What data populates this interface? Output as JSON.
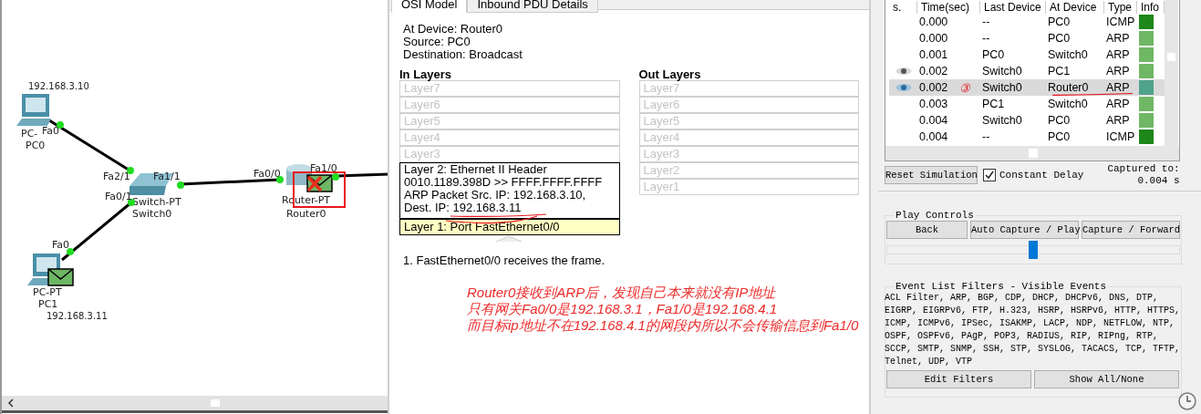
{
  "topology": {
    "devices": [
      {
        "kind": "pc",
        "model": "PC-",
        "name": "PC0",
        "ip": "192.168.3.10"
      },
      {
        "kind": "pc",
        "model": "PC-PT",
        "name": "PC1",
        "ip": "192.168.3.11",
        "has_pdu": true,
        "failed": false
      },
      {
        "kind": "switch",
        "model": "Switch-PT",
        "name": "Switch0"
      },
      {
        "kind": "router",
        "model": "Router-PT",
        "name": "Router0",
        "has_pdu": true,
        "failed": true,
        "highlighted": true
      }
    ],
    "ports": [
      "Fa0",
      "Fa2/1",
      "Fa1/1",
      "Fa0/1",
      "Fa0",
      "Fa0/0",
      "Fa1/0"
    ]
  },
  "pdu_window": {
    "tabs": [
      {
        "label": "OSI Model",
        "selected": true
      },
      {
        "label": "Inbound PDU Details",
        "selected": false
      }
    ],
    "info": [
      "At Device: Router0",
      "Source: PC0",
      "Destination: Broadcast"
    ],
    "in_layers": {
      "title": "In Layers",
      "layers": [
        {
          "lines": [
            "Layer7"
          ],
          "active": false,
          "selected": false
        },
        {
          "lines": [
            "Layer6"
          ],
          "active": false,
          "selected": false
        },
        {
          "lines": [
            "Layer5"
          ],
          "active": false,
          "selected": false
        },
        {
          "lines": [
            "Layer4"
          ],
          "active": false,
          "selected": false
        },
        {
          "lines": [
            "Layer3"
          ],
          "active": false,
          "selected": false
        },
        {
          "lines": [
            "Layer 2: Ethernet II Header",
            "0010.1189.398D >> FFFF.FFFF.FFFF",
            "ARP Packet Src. IP: 192.168.3.10,",
            "Dest. IP: 192.168.3.11"
          ],
          "active": true,
          "selected": false
        },
        {
          "lines": [
            "Layer 1: Port FastEthernet0/0"
          ],
          "active": true,
          "selected": true
        }
      ]
    },
    "out_layers": {
      "title": "Out Layers",
      "layers": [
        {
          "lines": [
            "Layer7"
          ],
          "active": false,
          "selected": false
        },
        {
          "lines": [
            "Layer6"
          ],
          "active": false,
          "selected": false
        },
        {
          "lines": [
            "Layer5"
          ],
          "active": false,
          "selected": false
        },
        {
          "lines": [
            "Layer4"
          ],
          "active": false,
          "selected": false
        },
        {
          "lines": [
            "Layer3"
          ],
          "active": false,
          "selected": false
        },
        {
          "lines": [
            "Layer2"
          ],
          "active": false,
          "selected": false
        },
        {
          "lines": [
            "Layer1"
          ],
          "active": false,
          "selected": false
        }
      ]
    },
    "steps": [
      "1. FastEthernet0/0 receives the frame."
    ],
    "annotation": [
      "Router0接收到ARP后，发现自己本来就没有IP地址",
      "只有网关Fa0/0是192.168.3.1，Fa1/0是192.168.4.1",
      "而目标ip地址不在192.168.4.1的网段内所以不会传输信息到Fa1/0"
    ]
  },
  "event_list": {
    "columns": [
      "s.",
      "Time(sec)",
      "Last Device",
      "At Device",
      "Type",
      "Info"
    ],
    "step_mark": "③",
    "events": [
      {
        "time": "0.000",
        "last": "--",
        "at": "PC0",
        "type": "ICMP",
        "color": "#1e8719",
        "viewed": false,
        "selected": false
      },
      {
        "time": "0.000",
        "last": "--",
        "at": "PC0",
        "type": "ARP",
        "color": "#70b765",
        "viewed": false,
        "selected": false
      },
      {
        "time": "0.001",
        "last": "PC0",
        "at": "Switch0",
        "type": "ARP",
        "color": "#70b765",
        "viewed": false,
        "selected": false
      },
      {
        "time": "0.002",
        "last": "Switch0",
        "at": "PC1",
        "type": "ARP",
        "color": "#70b765",
        "viewed": true,
        "selected": false
      },
      {
        "time": "0.002",
        "last": "Switch0",
        "at": "Router0",
        "type": "ARP",
        "color": "#4fa38a",
        "viewed": true,
        "selected": true
      },
      {
        "time": "0.003",
        "last": "PC1",
        "at": "Switch0",
        "type": "ARP",
        "color": "#70b765",
        "viewed": false,
        "selected": false
      },
      {
        "time": "0.004",
        "last": "Switch0",
        "at": "PC0",
        "type": "ARP",
        "color": "#70b765",
        "viewed": false,
        "selected": false
      },
      {
        "time": "0.004",
        "last": "--",
        "at": "PC0",
        "type": "ICMP",
        "color": "#1e8719",
        "viewed": false,
        "selected": false
      }
    ]
  },
  "simulation": {
    "reset_button": "Reset Simulation",
    "constant_delay": {
      "label": "Constant Delay",
      "checked": true
    },
    "captured_label": "Captured to:",
    "captured_value": "0.004 s"
  },
  "play_controls": {
    "title": "Play Controls",
    "buttons": [
      "Back",
      "Auto Capture / Play",
      "Capture / Forward"
    ],
    "speed": {
      "level": 0.5
    }
  },
  "filters": {
    "title": "Event List Filters - Visible Events",
    "text": "ACL Filter, ARP, BGP, CDP, DHCP, DHCPv6, DNS, DTP, EIGRP, EIGRPv6, FTP, H.323, HSRP, HSRPv6, HTTP, HTTPS, ICMP, ICMPv6, IPSec, ISAKMP, LACP, NDP, NETFLOW, NTP, OSPF, OSPFv6, PAgP, POP3, RADIUS, RIP, RIPng, RTP, SCCP, SMTP, SNMP, SSH, STP, SYSLOG, TACACS, TCP, TFTP, Telnet, UDP, VTP",
    "buttons": [
      "Edit Filters",
      "Show All/None"
    ]
  }
}
